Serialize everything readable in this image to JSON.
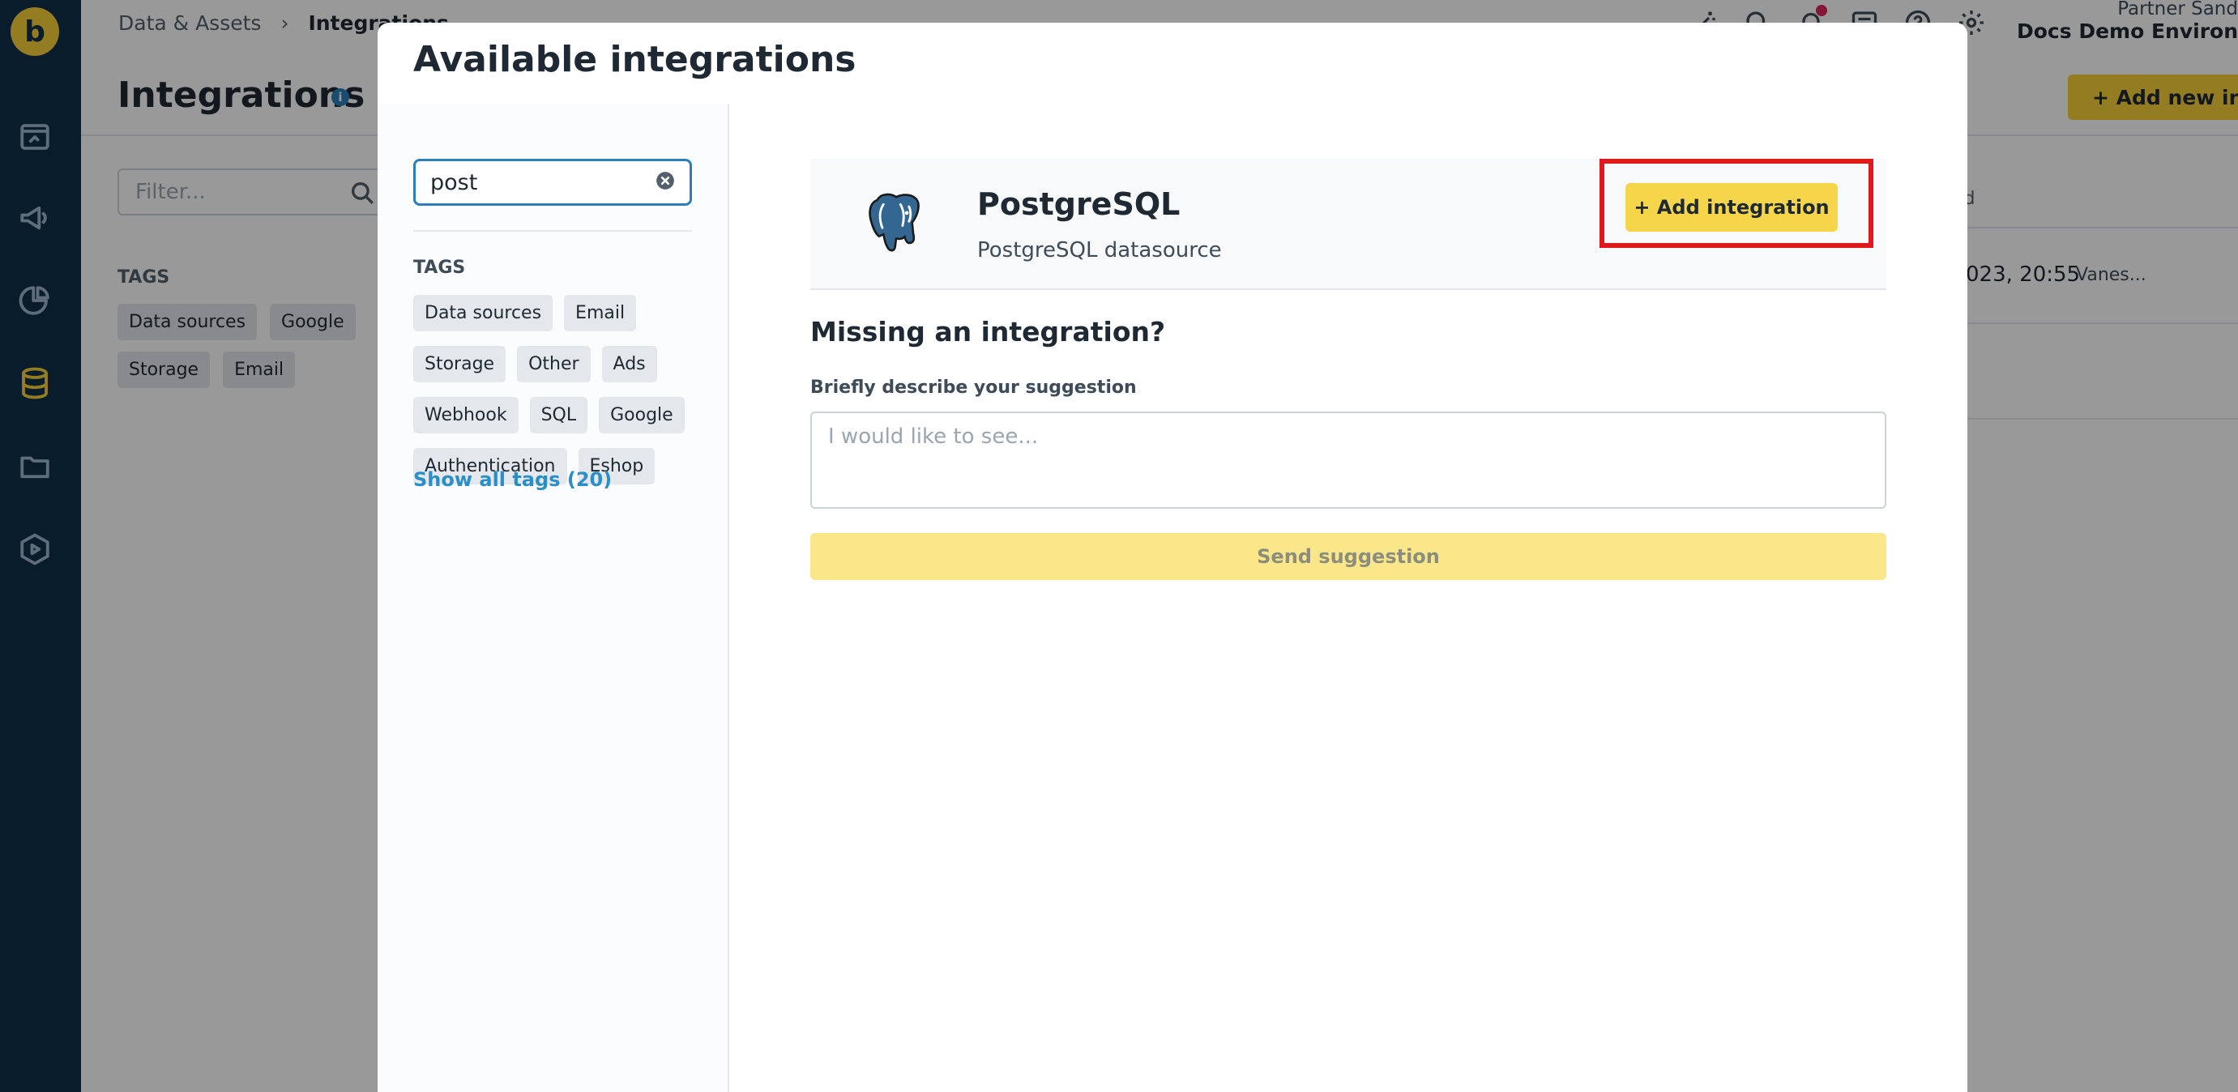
{
  "app": {
    "logo_letter": "b",
    "breadcrumb": [
      "Data & Assets",
      "Integrations"
    ],
    "environment": {
      "partner": "Partner Sand",
      "name": "Docs Demo Environ"
    }
  },
  "sidebar": {
    "icons": [
      "dashboard-icon",
      "campaigns-megaphone-icon",
      "analytics-pie-icon",
      "data-database-icon",
      "assets-folder-icon",
      "scenarios-play-icon"
    ],
    "active": "data-database-icon"
  },
  "page": {
    "title": "Integrations",
    "add_button": "+ Add new integ",
    "filter_placeholder": "Filter...",
    "tags_label": "TAGS",
    "tags": [
      "Data sources",
      "Google",
      "Storage",
      "Email"
    ],
    "table": {
      "column_partial": "ed",
      "rows": [
        {
          "date_partial": "023, 20:55",
          "user_partial": "Vanes..."
        }
      ]
    }
  },
  "modal": {
    "title": "Available integrations",
    "search_value": "post",
    "tags_label": "TAGS",
    "tags": [
      "Data sources",
      "Email",
      "Storage",
      "Other",
      "Ads",
      "Webhook",
      "SQL",
      "Google",
      "Authentication",
      "Eshop"
    ],
    "show_all_tags": "Show all tags (20)",
    "result": {
      "name": "PostgreSQL",
      "description": "PostgreSQL datasource",
      "add_button": "+ Add integration"
    },
    "missing": {
      "title": "Missing an integration?",
      "label": "Briefly describe your suggestion",
      "placeholder": "I would like to see...",
      "send_button": "Send suggestion"
    }
  },
  "colors": {
    "sidebar": "#0f2f4a",
    "accent_yellow": "#f5cf3a",
    "link_blue": "#2a8fc7",
    "highlight_red": "#e0191e"
  }
}
